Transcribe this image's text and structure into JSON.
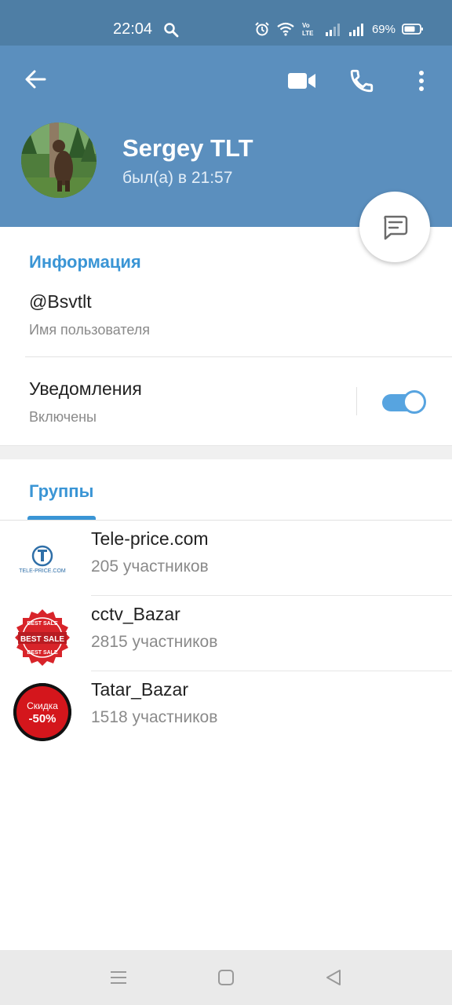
{
  "status_bar": {
    "time": "22:04",
    "battery_percent": "69%",
    "icons": [
      "search-icon",
      "alarm-icon",
      "wifi-icon",
      "volte-icon",
      "signal-icon",
      "signal-icon",
      "battery-icon"
    ]
  },
  "header": {
    "name": "Sergey TLT",
    "last_seen": "был(а) в 21:57",
    "background_color": "#5b8fbe",
    "actions": [
      "back-icon",
      "video-call-icon",
      "phone-icon",
      "more-vertical-icon"
    ]
  },
  "info": {
    "section_title": "Информация",
    "username": "@Bsvtlt",
    "username_label": "Имя пользователя",
    "notifications_title": "Уведомления",
    "notifications_status": "Включены",
    "notifications_enabled": true,
    "accent_color": "#3a95d5"
  },
  "groups": {
    "tab_label": "Группы",
    "items": [
      {
        "name": "Tele-price.com",
        "members": "205 участников",
        "avatar_text": "TELE-PRICE.COM"
      },
      {
        "name": "cctv_Bazar",
        "members": "2815 участников",
        "avatar_text_top": "BEST SALE",
        "avatar_text_mid": "BEST SALE",
        "avatar_text_bottom": "BEST SALE"
      },
      {
        "name": "Tatar_Bazar",
        "members": "1518 участников",
        "avatar_text_top": "Скидка",
        "avatar_text_bottom": "-50%"
      }
    ]
  },
  "nav_bar": {
    "buttons": [
      "menu-icon",
      "home-icon",
      "back-triangle-icon"
    ]
  }
}
